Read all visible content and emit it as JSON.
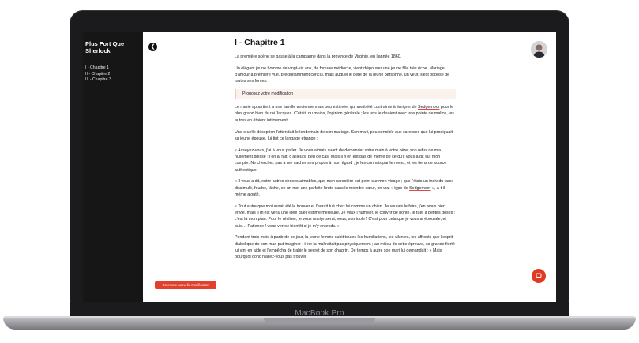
{
  "device": {
    "brand": "MacBook Pro"
  },
  "sidebar": {
    "title": "Plus Fort Que Sherlock",
    "items": [
      {
        "label": "I - Chapitre 1"
      },
      {
        "label": "II - Chapitre 2"
      },
      {
        "label": "III - Chapitre 3"
      }
    ]
  },
  "actions": {
    "create_label": "Créer une nouvelle modification",
    "back_icon": "chevron-left-icon",
    "comment_icon": "comment-icon"
  },
  "colors": {
    "accent": "#e23a22",
    "sidebar_bg": "#161617"
  },
  "chapter": {
    "title": "I - Chapitre 1",
    "p1": "La première scène se passe à la campagne dans la province de Virginie, en l'année 1860.",
    "p2": "Un élégant jeune homme de vingt-six ans, de fortune médiocre, vient d'épouser une jeune fille très riche. Mariage d'amour à première vue, précipitamment conclu, mais auquel le père de la jeune personne, un veuf, s'est opposé de toutes ses forces.",
    "proposal": "Proposez votre modification !",
    "p3_a": "Le marié appartient à une famille ancienne mais peu estimée, qui avait été contrainte à émigrer de ",
    "p3_link": "Sedgemoor",
    "p3_b": " pour le plus grand bien du roi Jacques. C'était, du moins, l'opinion générale ; les uns le disaient avec une pointe de malice, les autres en étaient intimement.",
    "p4": "Une cruelle déception l'attendait le lendemain de son mariage. Son mari, peu sensible aux caresses que lui prodiguait sa jeune épouse, lui tint ce langage étrange :",
    "p5": "« Asseyez-vous, j'ai à vous parler. Je vous aimais avant de demander votre main à votre père, son refus ne m'a nullement blessé ; j'en ai fait, d'ailleurs, peu de cas. Mais il n'en est pas de même de ce qu'il vous a dit sur mon compte. Ne cherchez pas à me cacher ses propos à mon égard ; je les connais par le menu, et les tiens de source authentique.",
    "p6_a": "« Il vous a dit, entre autres choses aimables, que mon caractère est peint sur mon visage ; que j'étais un individu faux, dissimulé, fourbe, lâche, en un mot une parfaite brute sans le moindre cœur, un vrai « type de ",
    "p6_link": "Sedgemoor",
    "p6_b": " », a-t-il même ajouté.",
    "p7": "« Tout autre que moi aurait été le trouver et l'aurait tué chez lui comme un chien. Je voulais le faire, j'en avais bien envie, mais il m'est venu une idée que j'estime meilleure. Je veux l'humilier, le couvrir de honte, le tuer à petites doses : c'est là mon plan. Pour le réaliser, je vous martyriserai, vous, son idole ! C'est pour cela que je vous ai épousée, et puis… Patience ! vous verrez bientôt si je m'y entends. »",
    "p8": "Pendant trois mois à partir de ce jour, la jeune femme subit toutes les humiliations, les vilenies, les affronts que l'esprit diabolique de son mari put imaginer ; il ne la maltraitait pas physiquement ; au milieu de cette épreuve, sa grande fierté lui vint en aide et l'empêcha de trahir le secret de son chagrin. De temps à autre son mari lui demandait : « Mais pourquoi donc n'allez-vous pas trouver"
  }
}
